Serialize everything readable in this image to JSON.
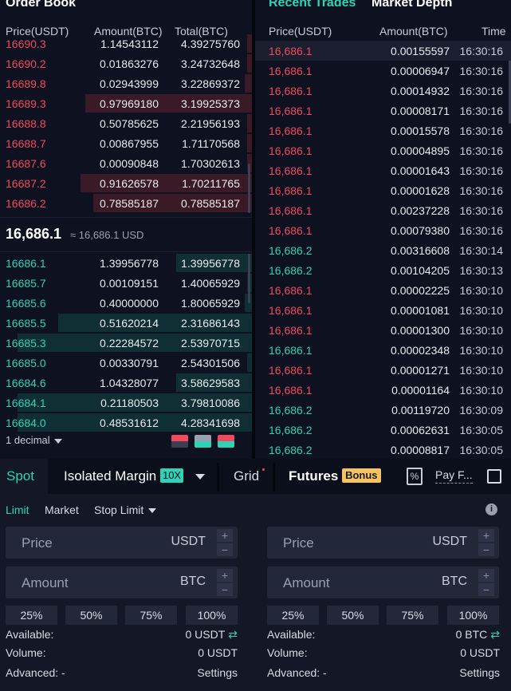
{
  "orderbook": {
    "title": "Order Book",
    "headers": {
      "price": "Price(USDT)",
      "amount": "Amount(BTC)",
      "total": "Total(BTC)"
    },
    "asks": [
      {
        "price": "16690.3",
        "amount": "1.14543112",
        "total": "4.39275760",
        "depth": 0.02
      },
      {
        "price": "16690.2",
        "amount": "0.01863276",
        "total": "3.24732648",
        "depth": 0.02
      },
      {
        "price": "16689.8",
        "amount": "0.02943999",
        "total": "3.22869372",
        "depth": 0.03
      },
      {
        "price": "16689.3",
        "amount": "0.97969180",
        "total": "3.19925373",
        "depth": 0.66
      },
      {
        "price": "16688.8",
        "amount": "0.50785625",
        "total": "2.21956193",
        "depth": 0.02
      },
      {
        "price": "16688.7",
        "amount": "0.00867955",
        "total": "1.71170568",
        "depth": 0.02
      },
      {
        "price": "16687.6",
        "amount": "0.00090848",
        "total": "1.70302613",
        "depth": 0.02
      },
      {
        "price": "16687.2",
        "amount": "0.91626578",
        "total": "1.70211765",
        "depth": 0.68
      },
      {
        "price": "16686.2",
        "amount": "0.78585187",
        "total": "0.78585187",
        "depth": 0.63
      }
    ],
    "last_price": "16,686.1",
    "last_price_usd": "≈ 16,686.1 USD",
    "bids": [
      {
        "price": "16686.1",
        "amount": "1.39956778",
        "total": "1.39956778",
        "depth": 0.3
      },
      {
        "price": "16685.7",
        "amount": "0.00109151",
        "total": "1.40065929",
        "depth": 0.02
      },
      {
        "price": "16685.6",
        "amount": "0.40000000",
        "total": "1.80065929",
        "depth": 0.03
      },
      {
        "price": "16685.5",
        "amount": "0.51620214",
        "total": "2.31686143",
        "depth": 0.77
      },
      {
        "price": "16685.3",
        "amount": "0.22284572",
        "total": "2.53970715",
        "depth": 0.93
      },
      {
        "price": "16685.0",
        "amount": "0.00330791",
        "total": "2.54301506",
        "depth": 0.02
      },
      {
        "price": "16684.6",
        "amount": "1.04328077",
        "total": "3.58629583",
        "depth": 0.3
      },
      {
        "price": "16684.1",
        "amount": "0.21180503",
        "total": "3.79810086",
        "depth": 0.93
      },
      {
        "price": "16684.0",
        "amount": "0.48531612",
        "total": "4.28341698",
        "depth": 0.93
      }
    ],
    "decimal_label": "1 decimal"
  },
  "trades": {
    "tab_recent": "Recent Trades",
    "tab_depth": "Market Depth",
    "headers": {
      "price": "Price(USDT)",
      "amount": "Amount(BTC)",
      "time": "Time"
    },
    "rows": [
      {
        "price": "16,686.1",
        "side": "sell",
        "amount": "0.00155597",
        "time": "16:30:16"
      },
      {
        "price": "16,686.1",
        "side": "sell",
        "amount": "0.00006947",
        "time": "16:30:16"
      },
      {
        "price": "16,686.1",
        "side": "sell",
        "amount": "0.00014932",
        "time": "16:30:16"
      },
      {
        "price": "16,686.1",
        "side": "sell",
        "amount": "0.00008171",
        "time": "16:30:16"
      },
      {
        "price": "16,686.1",
        "side": "sell",
        "amount": "0.00015578",
        "time": "16:30:16"
      },
      {
        "price": "16,686.1",
        "side": "sell",
        "amount": "0.00004895",
        "time": "16:30:16"
      },
      {
        "price": "16,686.1",
        "side": "sell",
        "amount": "0.00001643",
        "time": "16:30:16"
      },
      {
        "price": "16,686.1",
        "side": "sell",
        "amount": "0.00001628",
        "time": "16:30:16"
      },
      {
        "price": "16,686.1",
        "side": "sell",
        "amount": "0.00237228",
        "time": "16:30:16"
      },
      {
        "price": "16,686.1",
        "side": "sell",
        "amount": "0.00079380",
        "time": "16:30:16"
      },
      {
        "price": "16,686.2",
        "side": "buy",
        "amount": "0.00316608",
        "time": "16:30:14"
      },
      {
        "price": "16,686.2",
        "side": "buy",
        "amount": "0.00104205",
        "time": "16:30:13"
      },
      {
        "price": "16,686.1",
        "side": "sell",
        "amount": "0.00002225",
        "time": "16:30:10"
      },
      {
        "price": "16,686.1",
        "side": "sell",
        "amount": "0.00001081",
        "time": "16:30:10"
      },
      {
        "price": "16,686.1",
        "side": "sell",
        "amount": "0.00001300",
        "time": "16:30:10"
      },
      {
        "price": "16,686.1",
        "side": "buy",
        "amount": "0.00002348",
        "time": "16:30:10"
      },
      {
        "price": "16,686.1",
        "side": "sell",
        "amount": "0.00001271",
        "time": "16:30:10"
      },
      {
        "price": "16,686.1",
        "side": "sell",
        "amount": "0.00001164",
        "time": "16:30:10"
      },
      {
        "price": "16,686.2",
        "side": "buy",
        "amount": "0.00119720",
        "time": "16:30:09"
      },
      {
        "price": "16,686.2",
        "side": "buy",
        "amount": "0.00062631",
        "time": "16:30:05"
      },
      {
        "price": "16,686.2",
        "side": "buy",
        "amount": "0.00008817",
        "time": "16:30:05"
      }
    ]
  },
  "tabs": {
    "spot": "Spot",
    "isolated": "Isolated Margin",
    "leverage": "10X",
    "grid": "Grid",
    "futures": "Futures",
    "bonus": "Bonus",
    "pay": "Pay F..."
  },
  "order_types": {
    "limit": "Limit",
    "market": "Market",
    "stop_limit": "Stop Limit"
  },
  "buy_form": {
    "price_label": "Price",
    "price_unit": "USDT",
    "amount_label": "Amount",
    "amount_unit": "BTC",
    "pcts": [
      "25%",
      "50%",
      "75%",
      "100%"
    ],
    "available_label": "Available:",
    "available_value": "0 USDT",
    "volume_label": "Volume:",
    "volume_value": "0 USDT",
    "advanced_label": "Advanced: -",
    "settings": "Settings"
  },
  "sell_form": {
    "price_label": "Price",
    "price_unit": "USDT",
    "amount_label": "Amount",
    "amount_unit": "BTC",
    "pcts": [
      "25%",
      "50%",
      "75%",
      "100%"
    ],
    "available_label": "Available:",
    "available_value": "0 BTC",
    "volume_label": "Volume:",
    "volume_value": "0 USDT",
    "advanced_label": "Advanced: -",
    "settings": "Settings"
  },
  "colors": {
    "sell": "#f2495e",
    "buy": "#2ed3b7",
    "background": "#0d1120",
    "accent": "#2ed3b7",
    "bonus": "#f4c35d"
  },
  "icons": [
    "chevron-down-icon",
    "layout-both-icon",
    "layout-bids-icon",
    "layout-asks-icon",
    "percent-icon",
    "info-icon",
    "swap-icon"
  ]
}
